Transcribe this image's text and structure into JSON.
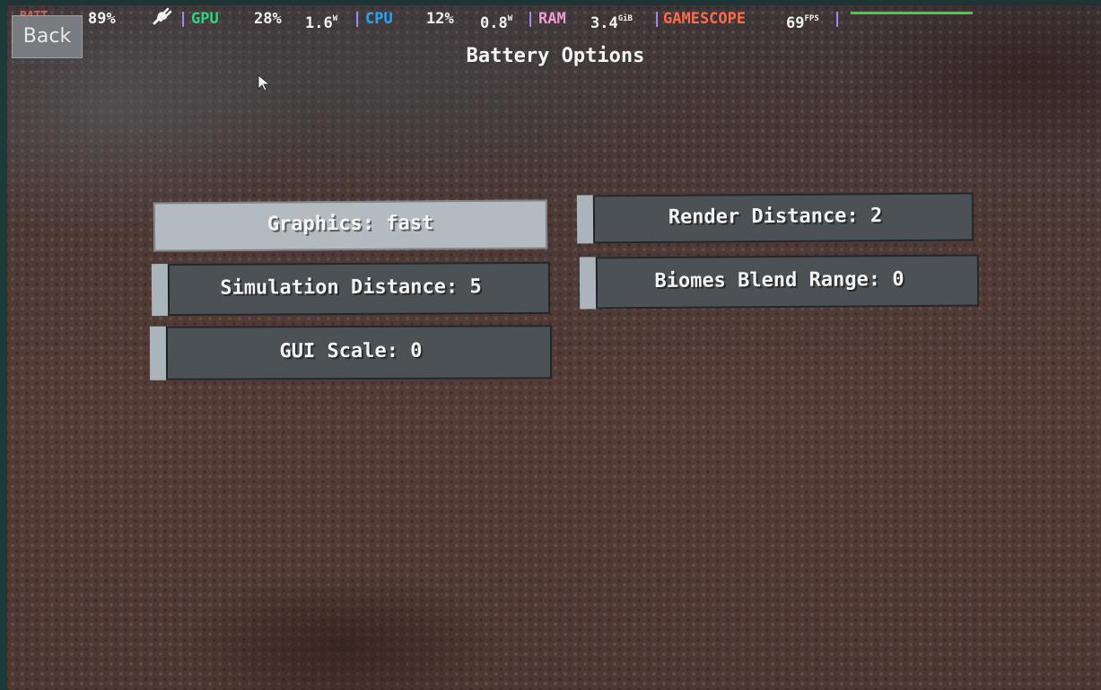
{
  "overlay": {
    "battery_label": "BATT",
    "battery_percent": "89%",
    "charging_icon": "plug-icon",
    "gpu": {
      "label": "GPU",
      "usage": "28%",
      "power": "1.6",
      "power_unit": "W"
    },
    "cpu": {
      "label": "CPU",
      "usage": "12%",
      "power": "0.8",
      "power_unit": "W"
    },
    "ram": {
      "label": "RAM",
      "value": "3.4",
      "unit": "GiB"
    },
    "gamescope": {
      "label": "GAMESCOPE",
      "fps": "69",
      "fps_unit": "FPS"
    },
    "separator": "|",
    "colors": {
      "gpu": "#34d17a",
      "cpu": "#2ba6ee",
      "ram": "#ef9ad2",
      "gamescope": "#ff6a4a",
      "frametime_graph": "#40d040"
    }
  },
  "back_button": {
    "label": "Back"
  },
  "screen": {
    "title": "Battery Options"
  },
  "options": [
    {
      "label": "Graphics: fast",
      "type": "button",
      "state": "highlighted"
    },
    {
      "label": "Render Distance: 2",
      "type": "slider",
      "value": 2
    },
    {
      "label": "Simulation Distance: 5",
      "type": "slider",
      "value": 5
    },
    {
      "label": "Biomes Blend Range: 0",
      "type": "slider",
      "value": 0
    },
    {
      "label": "GUI Scale: 0",
      "type": "slider",
      "value": 0
    }
  ]
}
